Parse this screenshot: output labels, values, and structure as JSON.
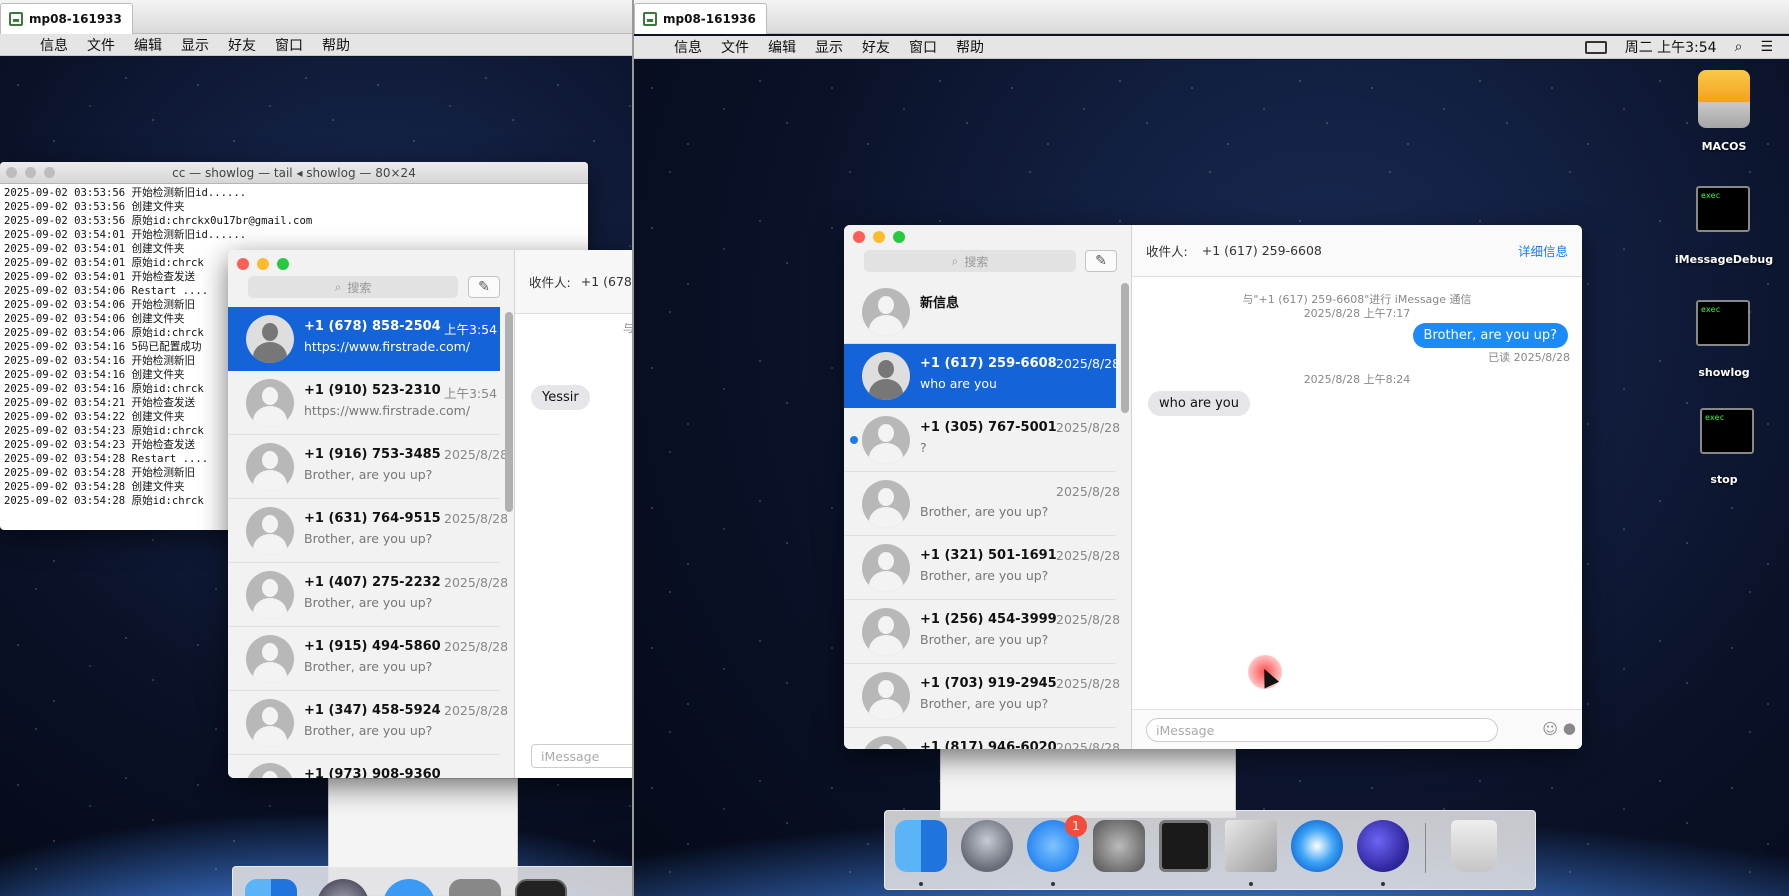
{
  "left_vm": {
    "tab": "mp08-161933",
    "menu": [
      "信息",
      "文件",
      "编辑",
      "显示",
      "好友",
      "窗口",
      "帮助"
    ],
    "terminal": {
      "title": "cc — showlog — tail ◂ showlog — 80×24",
      "lines": [
        "2025-09-02 03:53:56 开始检测新旧id......",
        "2025-09-02 03:53:56 创建文件夹",
        "2025-09-02 03:53:56 原始id:chrckx0u17br@gmail.com",
        "2025-09-02 03:54:01 开始检测新旧id......",
        "2025-09-02 03:54:01 创建文件夹",
        "2025-09-02 03:54:01 原始id:chrck",
        "2025-09-02 03:54:01 开始检查发送",
        "2025-09-02 03:54:06 Restart ....",
        "2025-09-02 03:54:06 开始检测新旧",
        "2025-09-02 03:54:06 创建文件夹",
        "2025-09-02 03:54:06 原始id:chrck",
        "2025-09-02 03:54:16 5码已配置成功",
        "2025-09-02 03:54:16 开始检测新旧",
        "2025-09-02 03:54:16 创建文件夹",
        "2025-09-02 03:54:16 原始id:chrck",
        "2025-09-02 03:54:21 开始检查发送",
        "2025-09-02 03:54:22 创建文件夹",
        "2025-09-02 03:54:23 原始id:chrck",
        "2025-09-02 03:54:23 开始检查发送",
        "2025-09-02 03:54:28 Restart ....",
        "2025-09-02 03:54:28 开始检测新旧",
        "2025-09-02 03:54:28 创建文件夹",
        "2025-09-02 03:54:28 原始id:chrck"
      ]
    },
    "messages": {
      "search_placeholder": "搜索",
      "recipient_label": "收件人:",
      "recipient_value": "+1 (678",
      "header_tail": "与",
      "bubble_in": "Yessir",
      "input_placeholder": "iMessage",
      "conversations": [
        {
          "name": "+1 (678) 858-2504",
          "msg": "https://www.firstrade.com/",
          "date": "上午3:54"
        },
        {
          "name": "+1 (910) 523-2310",
          "msg": "https://www.firstrade.com/",
          "date": "上午3:54"
        },
        {
          "name": "+1 (916) 753-3485",
          "msg": "Brother, are you up?",
          "date": "2025/8/28"
        },
        {
          "name": "+1 (631) 764-9515",
          "msg": "Brother, are you up?",
          "date": "2025/8/28"
        },
        {
          "name": "+1 (407) 275-2232",
          "msg": "Brother, are you up?",
          "date": "2025/8/28"
        },
        {
          "name": "+1 (915) 494-5860",
          "msg": "Brother, are you up?",
          "date": "2025/8/28"
        },
        {
          "name": "+1 (347) 458-5924",
          "msg": "Brother, are you up?",
          "date": "2025/8/28"
        },
        {
          "name": "+1 (973) 908-9360",
          "msg": "",
          "date": ""
        }
      ]
    }
  },
  "right_vm": {
    "tab": "mp08-161936",
    "menu": [
      "信息",
      "文件",
      "编辑",
      "显示",
      "好友",
      "窗口",
      "帮助"
    ],
    "clock": "周二 上午3:54",
    "desktop_icons": [
      {
        "label": "MACOS",
        "icon": "drive-icon"
      },
      {
        "label": "iMessageDebug",
        "icon": "exec-icon",
        "exec": "exec"
      },
      {
        "label": "showlog",
        "icon": "exec-icon",
        "exec": "exec"
      },
      {
        "label": "stop",
        "icon": "exec-icon",
        "exec": "exec"
      }
    ],
    "messages": {
      "search_placeholder": "搜索",
      "recipient_label": "收件人:",
      "recipient_value": "+1 (617) 259-6608",
      "details_link": "详细信息",
      "thread_info_1": "与\"+1 (617) 259-6608\"进行 iMessage 通信",
      "thread_info_2": "2025/8/28 上午7:17",
      "bubble_out": "Brother, are you up?",
      "read_receipt": "已读 2025/8/28",
      "timestamp_2": "2025/8/28 上午8:24",
      "bubble_in": "who are you",
      "input_placeholder": "iMessage",
      "conversations": [
        {
          "name": "新信息",
          "msg": "",
          "date": ""
        },
        {
          "name": "+1 (617) 259-6608",
          "msg": "who are you",
          "date": "2025/8/28"
        },
        {
          "name": "+1 (305) 767-5001",
          "msg": "?",
          "date": "2025/8/28"
        },
        {
          "name": "",
          "msg": "Brother, are you up?",
          "date": "2025/8/28"
        },
        {
          "name": "+1 (321) 501-1691",
          "msg": "Brother, are you up?",
          "date": "2025/8/28"
        },
        {
          "name": "+1 (256) 454-3999",
          "msg": "Brother, are you up?",
          "date": "2025/8/28"
        },
        {
          "name": "+1 (703) 919-2945",
          "msg": "Brother, are you up?",
          "date": "2025/8/28"
        },
        {
          "name": "+1 (817) 946-6020",
          "msg": "",
          "date": "2025/8/28"
        }
      ]
    },
    "dock": {
      "messages_badge": "1"
    }
  },
  "colors": {
    "accent": "#1463d9",
    "bubble_out": "#1b8cf7"
  }
}
